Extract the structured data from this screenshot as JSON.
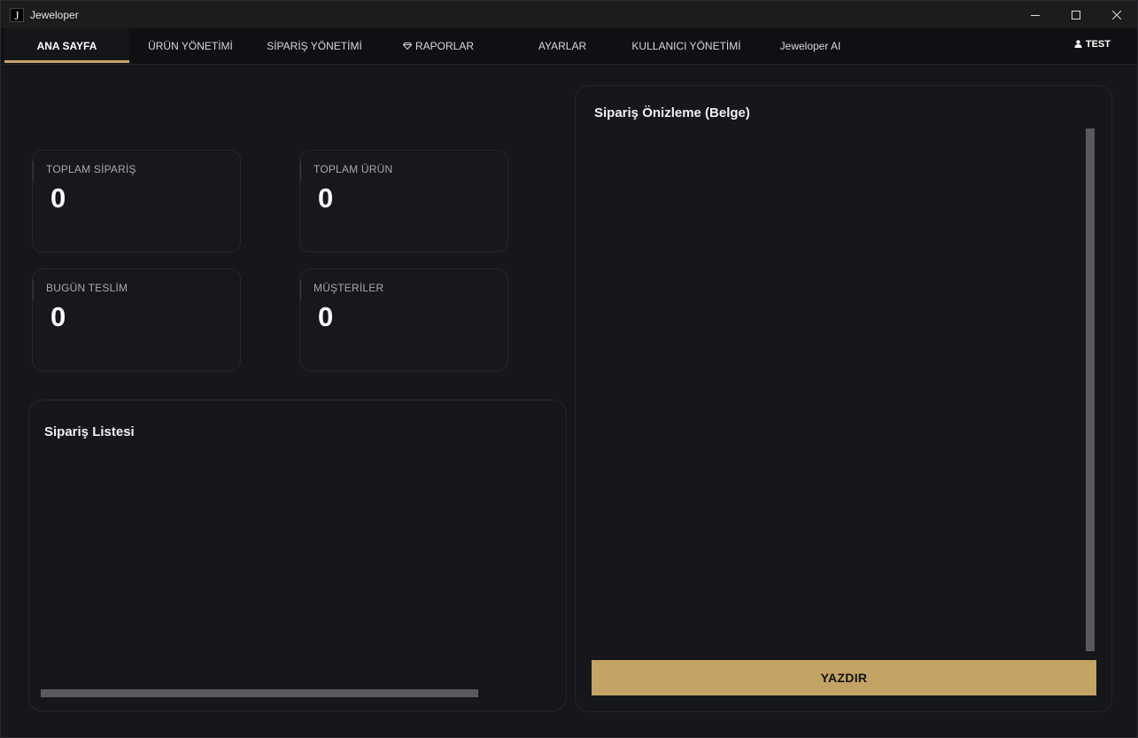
{
  "window": {
    "app_icon_letter": "J",
    "title": "Jeweloper"
  },
  "nav": {
    "tabs": [
      {
        "label": "ANA SAYFA",
        "active": true
      },
      {
        "label": "ÜRÜN YÖNETİMİ"
      },
      {
        "label": "SİPARİŞ YÖNETİMİ"
      },
      {
        "label": "RAPORLAR",
        "icon": "gem-icon"
      },
      {
        "label": "AYARLAR"
      },
      {
        "label": "KULLANICI YÖNETİMİ"
      },
      {
        "label": "Jeweloper AI"
      }
    ],
    "user": {
      "label": "TEST",
      "icon": "user-icon"
    }
  },
  "stats": [
    {
      "label": "TOPLAM SİPARİŞ",
      "value": "0"
    },
    {
      "label": "TOPLAM ÜRÜN",
      "value": "0"
    },
    {
      "label": "BUGÜN TESLİM",
      "value": "0"
    },
    {
      "label": "MÜŞTERİLER",
      "value": "0"
    }
  ],
  "order_list": {
    "title": "Sipariş Listesi"
  },
  "preview": {
    "title": "Sipariş Önizleme (Belge)",
    "print_label": "YAZDIR"
  },
  "colors": {
    "accent": "#c4a465",
    "background": "#16171b",
    "navbar": "#0f1013"
  }
}
